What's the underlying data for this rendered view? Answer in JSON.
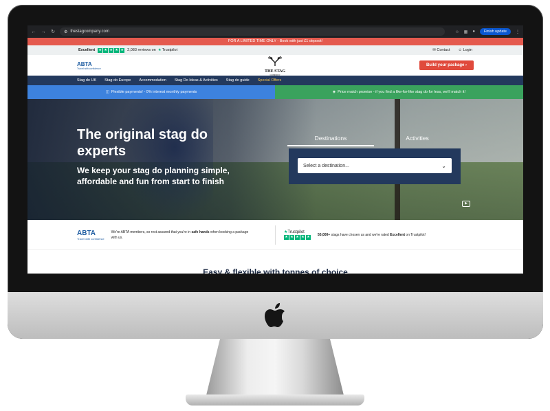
{
  "browser": {
    "url": "thestagcompany.com",
    "update_label": "Finish update"
  },
  "promo": {
    "text": "FOR A LIMITED TIME ONLY - Book with just £1 deposit!"
  },
  "trustbar": {
    "rating_label": "Excellent",
    "reviews_text": "2,083 reviews on",
    "trustpilot_label": "Trustpilot",
    "contact_label": "Contact",
    "login_label": "Login"
  },
  "header": {
    "abta_name": "ABTA",
    "abta_tagline": "Travel with confidence",
    "brand_name": "THE STAG",
    "brand_sub": "COMPANY",
    "cta_label": "Build your package"
  },
  "nav": {
    "items": [
      "Stag do UK",
      "Stag do Europe",
      "Accommodation",
      "Stag Do Ideas & Activities",
      "Stag do guide",
      "Special Offers"
    ]
  },
  "info": {
    "left": "Flexible payments! - 0% interest monthly payments",
    "right": "Price match promise - if you find a like-for-like stag do for less, we'll match it!"
  },
  "hero": {
    "title": "The original stag do experts",
    "subtitle": "We keep your stag do planning simple, affordable and fun from start to finish",
    "tabs": [
      "Destinations",
      "Activities"
    ],
    "select_placeholder": "Select a destination..."
  },
  "trust_strip": {
    "abta_text_before": "We're ABTA members, so rest assured that you're in ",
    "abta_text_bold": "safe hands",
    "abta_text_after": " when booking a package with us.",
    "tp_label": "Trustpilot",
    "tp_text_bold1": "50,000+",
    "tp_text_mid": " stags have chosen us and we're rated ",
    "tp_text_bold2": "Excellent",
    "tp_text_after": " on Trustpilot!"
  },
  "section": {
    "heading": "Easy & flexible with tonnes of choice"
  },
  "colors": {
    "navy": "#23395d",
    "red": "#e04a3c",
    "blue": "#3d82de",
    "green": "#3aa25d",
    "trustpilot": "#00b67a"
  }
}
